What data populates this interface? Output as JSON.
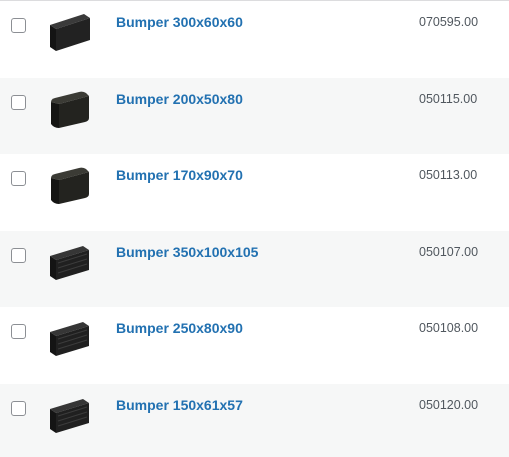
{
  "products": [
    {
      "name": "Bumper 300x60x60",
      "sku": "070595.00",
      "thumbnail": "bumper-flat-block"
    },
    {
      "name": "Bumper 200x50x80",
      "sku": "050115.00",
      "thumbnail": "bumper-rounded-block"
    },
    {
      "name": "Bumper 170x90x70",
      "sku": "050113.00",
      "thumbnail": "bumper-rounded-block"
    },
    {
      "name": "Bumper 350x100x105",
      "sku": "050107.00",
      "thumbnail": "bumper-ribbed-block"
    },
    {
      "name": "Bumper 250x80x90",
      "sku": "050108.00",
      "thumbnail": "bumper-ribbed-block"
    },
    {
      "name": "Bumper 150x61x57",
      "sku": "050120.00",
      "thumbnail": "bumper-ribbed-block"
    }
  ],
  "colors": {
    "link": "#2271b1",
    "alt_row": "#f6f7f7",
    "sku_text": "#50575e",
    "product_black": "#1d1d1d"
  }
}
